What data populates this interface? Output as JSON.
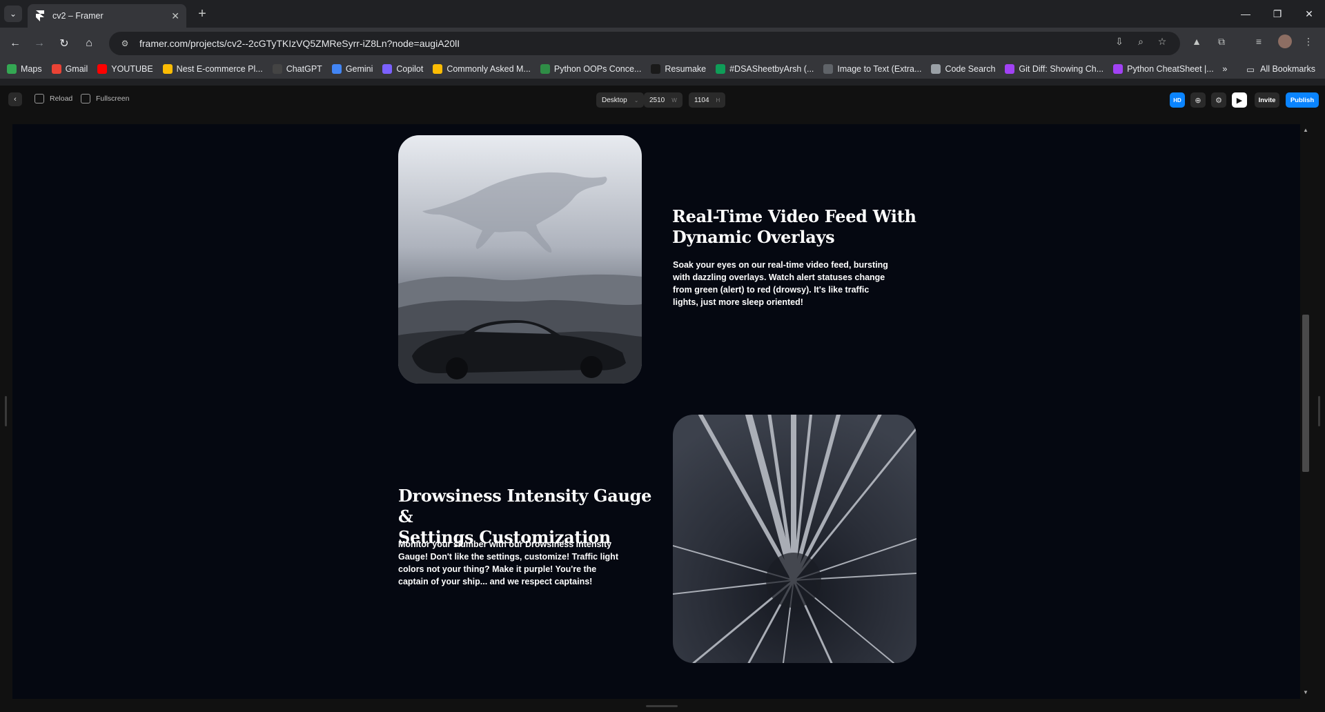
{
  "browser": {
    "tab": {
      "title": "cv2 – Framer",
      "favicon": "framer-logo-icon"
    },
    "url": "framer.com/projects/cv2--2cGTyTKIzVQ5ZMReSyrr-iZ8Ln?node=augiA20lI",
    "bookmarks": [
      {
        "label": "Maps",
        "icon": "maps-icon",
        "color": "#34a853"
      },
      {
        "label": "Gmail",
        "icon": "gmail-icon",
        "color": "#ea4335"
      },
      {
        "label": "YOUTUBE",
        "icon": "youtube-icon",
        "color": "#ff0000"
      },
      {
        "label": "Nest E-commerce Pl...",
        "icon": "drive-icon",
        "color": "#fbbc04"
      },
      {
        "label": "ChatGPT",
        "icon": "chatgpt-icon",
        "color": "#444444"
      },
      {
        "label": "Gemini",
        "icon": "gemini-icon",
        "color": "#4285f4"
      },
      {
        "label": "Copilot",
        "icon": "copilot-icon",
        "color": "#7b61ff"
      },
      {
        "label": "Commonly Asked M...",
        "icon": "drive-icon",
        "color": "#fbbc04"
      },
      {
        "label": "Python OOPs Conce...",
        "icon": "gfg-icon",
        "color": "#2f8d46"
      },
      {
        "label": "Resumake",
        "icon": "resumake-icon",
        "color": "#1a1a1a"
      },
      {
        "label": "#DSASheetbyArsh (...",
        "icon": "sheets-icon",
        "color": "#0f9d58"
      },
      {
        "label": "Image to Text (Extra...",
        "icon": "image-text-icon",
        "color": "#5f6368"
      },
      {
        "label": "Code Search",
        "icon": "code-search-icon",
        "color": "#9aa0a6"
      },
      {
        "label": "Git Diff: Showing Ch...",
        "icon": "git-icon",
        "color": "#a142f4"
      },
      {
        "label": "Python CheatSheet |...",
        "icon": "python-icon",
        "color": "#a142f4"
      }
    ],
    "all_bookmarks": "All Bookmarks",
    "overflow": "»"
  },
  "framer": {
    "reload": "Reload",
    "fullscreen": "Fullscreen",
    "device": "Desktop",
    "width": "2510",
    "width_suffix": "W",
    "height": "1104",
    "height_suffix": "H",
    "hd": "HD",
    "invite": "Invite",
    "publish": "Publish"
  },
  "content": {
    "section1": {
      "heading_line1": "Real-Time Video Feed With",
      "heading_line2": "Dynamic Overlays",
      "paragraph_lines": [
        "Soak your eyes on our real-time video feed, bursting",
        "with dazzling overlays. Watch alert statuses change",
        "from green (alert) to red (drowsy). It's like traffic",
        "lights, just more sleep oriented!"
      ]
    },
    "section2": {
      "heading_line1": "Drowsiness Intensity Gauge &",
      "heading_line2": "Settings Customization",
      "paragraph_lines": [
        "Monitor your slumber with our Drowsiness Intensity",
        "Gauge! Don't like the settings, customize! Traffic light",
        "colors not your thing? Make it purple! You're the",
        "captain of your ship... and we respect captains!"
      ]
    }
  }
}
